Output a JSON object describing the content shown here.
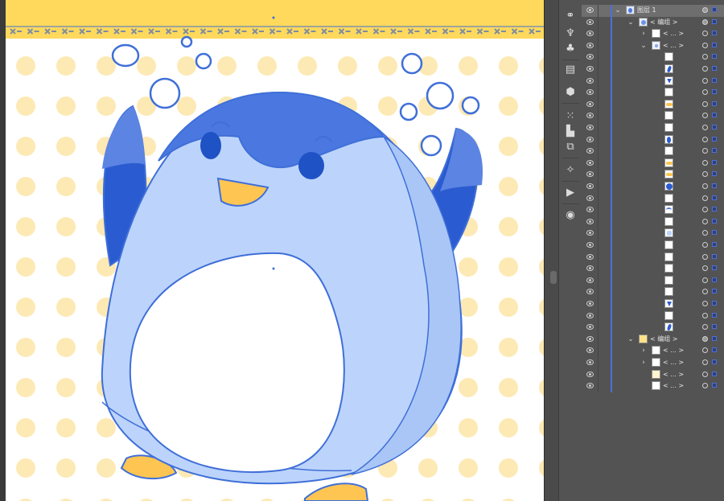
{
  "artboard": {
    "background": "#ffffff",
    "banner_color": "#ffd95c",
    "dot_color": "#fde9b4",
    "penguin_outline": "#3f6fd8"
  },
  "toolstrip": {
    "tools": [
      "link-icon",
      "puppet-warp-icon",
      "symbols-icon",
      "artboards-icon",
      "brushes-icon",
      "align-icon",
      "transform-icon",
      "magic-wand-icon",
      "actions-play-icon",
      "appearance-icon"
    ]
  },
  "layers": {
    "rows": [
      {
        "depth": 0,
        "label": "图层 1",
        "caret": "open",
        "thumb": "layer",
        "selected": true,
        "target": "filled"
      },
      {
        "depth": 1,
        "label": "< 编组 >",
        "caret": "open",
        "thumb": "group",
        "selected": false,
        "target": "filled"
      },
      {
        "depth": 2,
        "label": "< ... >",
        "caret": "closed",
        "thumb": "blank",
        "selected": false,
        "target": "empty"
      },
      {
        "depth": 2,
        "label": "< ... >",
        "caret": "open",
        "thumb": "group-small",
        "selected": false,
        "target": "empty"
      },
      {
        "depth": 3,
        "label": "",
        "thumb": "blank",
        "target": "empty"
      },
      {
        "depth": 3,
        "label": "",
        "thumb": "blue-shape",
        "target": "empty"
      },
      {
        "depth": 3,
        "label": "",
        "thumb": "blue-v",
        "target": "empty"
      },
      {
        "depth": 3,
        "label": "",
        "thumb": "blank",
        "target": "empty"
      },
      {
        "depth": 3,
        "label": "",
        "thumb": "yellow-shape",
        "target": "empty"
      },
      {
        "depth": 3,
        "label": "",
        "thumb": "blank",
        "target": "empty"
      },
      {
        "depth": 3,
        "label": "",
        "thumb": "blank",
        "target": "empty"
      },
      {
        "depth": 3,
        "label": "",
        "thumb": "blue-oval",
        "target": "empty"
      },
      {
        "depth": 3,
        "label": "",
        "thumb": "blank",
        "target": "empty"
      },
      {
        "depth": 3,
        "label": "",
        "thumb": "yellow-shape",
        "target": "empty"
      },
      {
        "depth": 3,
        "label": "",
        "thumb": "yellow-shape",
        "target": "empty"
      },
      {
        "depth": 3,
        "label": "",
        "thumb": "blue-circle",
        "target": "empty"
      },
      {
        "depth": 3,
        "label": "",
        "thumb": "blank",
        "target": "empty"
      },
      {
        "depth": 3,
        "label": "",
        "thumb": "blue-arc",
        "target": "empty"
      },
      {
        "depth": 3,
        "label": "",
        "thumb": "blank",
        "target": "empty"
      },
      {
        "depth": 3,
        "label": "",
        "thumb": "light-shape",
        "target": "empty"
      },
      {
        "depth": 3,
        "label": "",
        "thumb": "blank",
        "target": "empty"
      },
      {
        "depth": 3,
        "label": "",
        "thumb": "blank",
        "target": "empty"
      },
      {
        "depth": 3,
        "label": "",
        "thumb": "blank",
        "target": "empty"
      },
      {
        "depth": 3,
        "label": "",
        "thumb": "blank",
        "target": "empty"
      },
      {
        "depth": 3,
        "label": "",
        "thumb": "blank",
        "target": "empty"
      },
      {
        "depth": 3,
        "label": "",
        "thumb": "blue-v",
        "target": "empty"
      },
      {
        "depth": 3,
        "label": "",
        "thumb": "blank",
        "target": "empty"
      },
      {
        "depth": 3,
        "label": "",
        "thumb": "blue-shape",
        "target": "empty"
      },
      {
        "depth": 1,
        "label": "< 编组 >",
        "caret": "open",
        "thumb": "yellow-group",
        "selected": false,
        "target": "filled"
      },
      {
        "depth": 2,
        "label": "< ... >",
        "caret": "closed",
        "thumb": "blank",
        "target": "empty"
      },
      {
        "depth": 2,
        "label": "< ... >",
        "caret": "closed",
        "thumb": "blank",
        "target": "empty"
      },
      {
        "depth": 2,
        "label": "< ... >",
        "thumb": "cream",
        "target": "empty"
      },
      {
        "depth": 2,
        "label": "< ... >",
        "thumb": "blank",
        "target": "empty"
      }
    ]
  }
}
